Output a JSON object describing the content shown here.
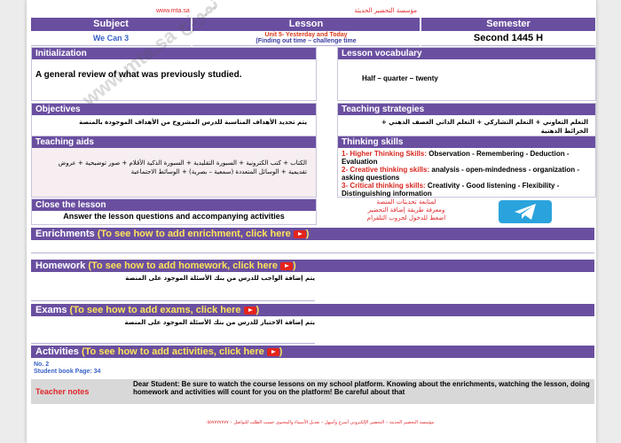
{
  "top": {
    "url": "www.mta.sa",
    "org": "مؤسسة التحضير الحديثة"
  },
  "header": {
    "subject_label": "Subject",
    "lesson_label": "Lesson",
    "semester_label": "Semester",
    "subject_value": "We Can 3",
    "lesson_line1": "Unit 5- Yesterday and Today",
    "lesson_line2": "(Finding out time – challenge time",
    "semester_value": "Second 1445 H"
  },
  "initialization": {
    "title": "Initialization",
    "text": "A general review of what was previously studied."
  },
  "vocabulary": {
    "title": "Lesson vocabulary",
    "text": "Half – quarter – twenty"
  },
  "objectives": {
    "title": "Objectives",
    "text": "يتم تحديد الأهداف المناسبة للدرس المشروح من الأهداف الموجودة بالمنصة"
  },
  "strategies": {
    "title": "Teaching strategies",
    "text": "التعلم التعاوني + التعلم التشاركي + التعلم الذاتي العصف الذهني + الخرائط الذهنية"
  },
  "aids": {
    "title": "Teaching aids",
    "text": "الكتاب + كتب الكترونية + السبورة التقليدية + السبورة الذكية الأقلام + صور توضيحية + عروض تقديمية + الوسائل المتعددة (سمعية – بصرية) + الوسائط الاجتماعية"
  },
  "thinking": {
    "title": "Thinking skills",
    "l1_label": "1- Higher Thinking Skills:",
    "l1_text": " Observation - Remembering - Deduction - Evaluation",
    "l2_label": "2- Creative thinking skills:",
    "l2_text": " analysis - open-mindedness - organization - asking questions",
    "l3_label": "3- Critical thinking skills:",
    "l3_text": " Creativity - Good listening - Flexibility - Distinguishing information"
  },
  "close": {
    "title": "Close the lesson",
    "text": "Answer the lesson questions and accompanying activities"
  },
  "telegram": {
    "line1": "لمتابعة تحديثات المنصة",
    "line2": "ومعرفة طريقة إضافة التحضير",
    "line3": "اضغط للدخول لجروب التلقرام"
  },
  "enrichments": {
    "label": "Enrichments",
    "link": "(To see how to add enrichment, click here",
    "end": ")"
  },
  "homework": {
    "label": "Homework",
    "link": "(To see how to add homework, click here",
    "end": ")",
    "text": "يتم إضافة الواجب للدرس من بنك الأسئلة الموجود على المنصة"
  },
  "exams": {
    "label": "Exams",
    "link": "(To see how to add exams, click here",
    "end": ")",
    "text": "يتم إضافة الاختبار للدرس من بنك الأسئلة الموجود على المنصة"
  },
  "activities": {
    "label": "Activities",
    "link": "(To see how to add activities, click here",
    "end": ")",
    "line1": "No. 2",
    "line2": "Student book Page: 34"
  },
  "teacher_notes": {
    "label": "Teacher notes",
    "text": "Dear Student: Be sure to watch the course lessons on my school platform. Knowing about the enrichments, watching the lesson, doing homework and activities will count for you on the platform! Be careful about that"
  },
  "watermark": "www.mta.sa  نموذج",
  "footer": "مؤسسة التحضير الحديثة – التحضير الإلكتروني أسرع وأسهل – تعديل الأسماء والمحتوى حسب الطلب للتواصل – ٠٥٥٧٧٧٧٧٧٧",
  "colors": {
    "primary": "#6a4fa0",
    "accent_red": "#e5231b",
    "link_yellow": "#ffe35a",
    "telegram": "#2aa3dd",
    "teacher_notes_bg": "#d8d8d8"
  }
}
